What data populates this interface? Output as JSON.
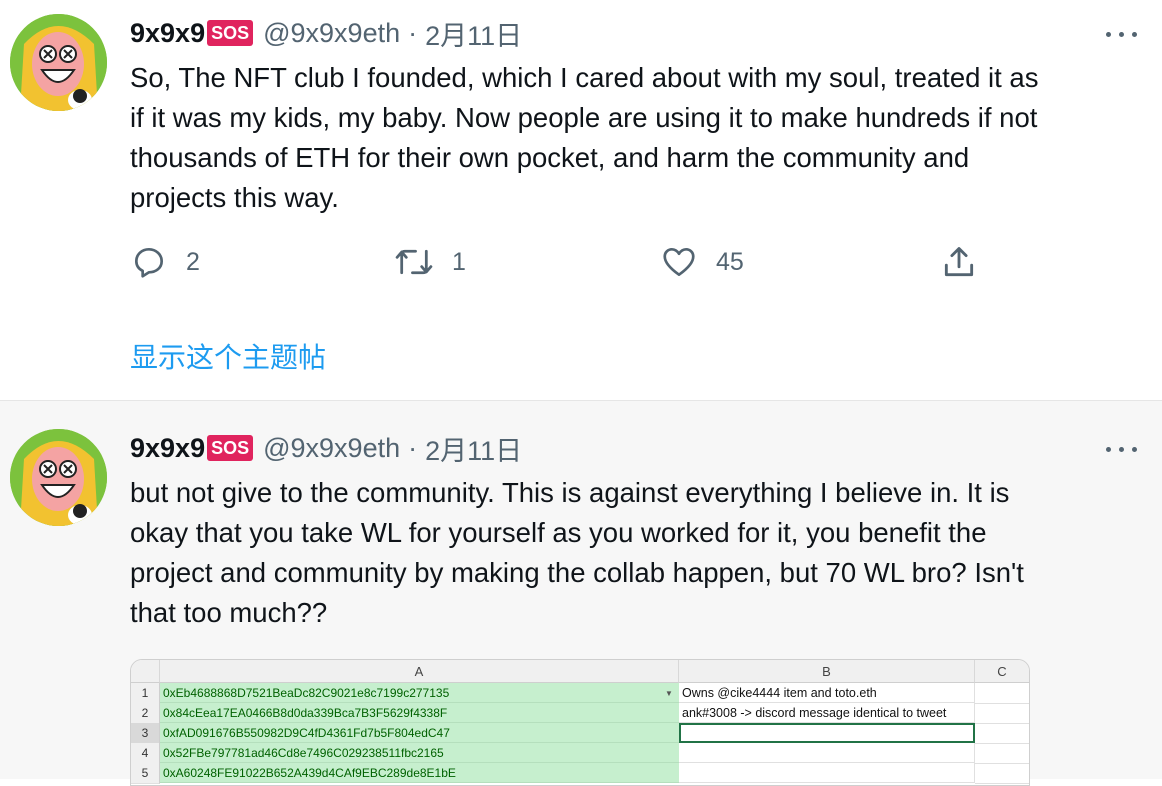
{
  "colors": {
    "accent": "#1d9bf0",
    "sos_badge": "#e0245e",
    "secondary_text": "#536471",
    "cell_green": "#c6efce"
  },
  "tweets": [
    {
      "author_name": "9x9x9",
      "badge": "SOS",
      "handle": "@9x9x9eth",
      "separator": "·",
      "date": "2月11日",
      "text_lines": [
        "So, The NFT club I founded, which I cared about with my soul, treated it as",
        "if it was my kids, my baby. Now people are using it to make hundreds if not",
        "thousands of ETH for their own pocket, and harm the community and",
        "projects this way."
      ],
      "replies": "2",
      "retweets": "1",
      "likes": "45",
      "show_thread": "显示这个主题帖"
    },
    {
      "author_name": "9x9x9",
      "badge": "SOS",
      "handle": "@9x9x9eth",
      "separator": "·",
      "date": "2月11日",
      "text_lines": [
        "but not give to the community. This is against everything I believe in. It is",
        "okay that you take WL for yourself as you worked for it, you benefit the",
        "project and community by making the collab happen, but 70 WL bro? Isn't",
        "that too much??"
      ]
    }
  ],
  "spreadsheet": {
    "columns": [
      "A",
      "B",
      "C"
    ],
    "rows": [
      {
        "num": "1",
        "a": "0xEb4688868D7521BeaDc82C9021e8c7199c277135",
        "b": "Owns @cike4444 item and toto.eth"
      },
      {
        "num": "2",
        "a": "0x84cEea17EA0466B8d0da339Bca7B3F5629f4338F",
        "b": "ank#3008 -> discord message identical to tweet"
      },
      {
        "num": "3",
        "a": "0xfAD091676B550982D9C4fD4361Fd7b5F804edC47",
        "b": ""
      },
      {
        "num": "4",
        "a": "0x52FBe797781ad46Cd8e7496C029238511fbc2165",
        "b": ""
      },
      {
        "num": "5",
        "a": "0xA60248FE91022B652A439d4CAf9EBC289de8E1bE",
        "b": ""
      }
    ]
  }
}
